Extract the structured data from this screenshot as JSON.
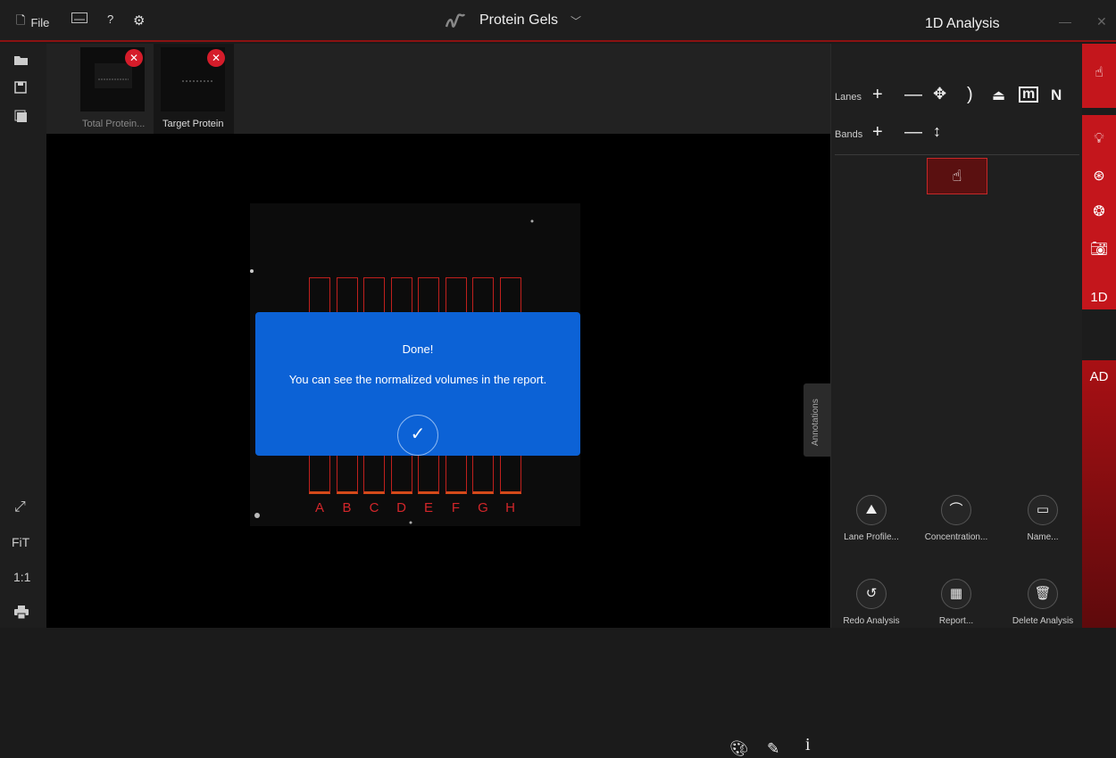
{
  "topbar": {
    "file_label": "File",
    "keyboard_icon": "keyboard-icon",
    "help_label": "?",
    "settings_icon": "gear-icon",
    "app_title": "Protein Gels",
    "panel_title": "1D Analysis",
    "minimize": "—",
    "close": "✕"
  },
  "left_toolbar": {
    "fit_label": "FiT",
    "one_to_one_label": "1:1"
  },
  "thumbnails": [
    {
      "caption": "Total Protein..."
    },
    {
      "caption": "Target Protein"
    }
  ],
  "gel": {
    "lanes": [
      "A",
      "B",
      "C",
      "D",
      "E",
      "F",
      "G",
      "H"
    ],
    "accent": "#c0201d"
  },
  "annotations_tab": "Annotations",
  "dialog": {
    "title": "Done!",
    "message": "You can see the normalized volumes in the report.",
    "ok_symbol": "✓",
    "color": "#0c62d6"
  },
  "right_panel": {
    "lanes_label": "Lanes",
    "bands_label": "Bands",
    "m_label": "m",
    "n_label": "N",
    "actions": [
      {
        "label": "Lane Profile..."
      },
      {
        "label": "Concentration..."
      },
      {
        "label": "Name..."
      },
      {
        "label": "Redo Analysis"
      },
      {
        "label": "Report..."
      },
      {
        "label": "Delete Analysis"
      }
    ]
  },
  "far_right": {
    "tab_1d": "1D",
    "tab_ad": "AD",
    "accent": "#c4161c"
  }
}
